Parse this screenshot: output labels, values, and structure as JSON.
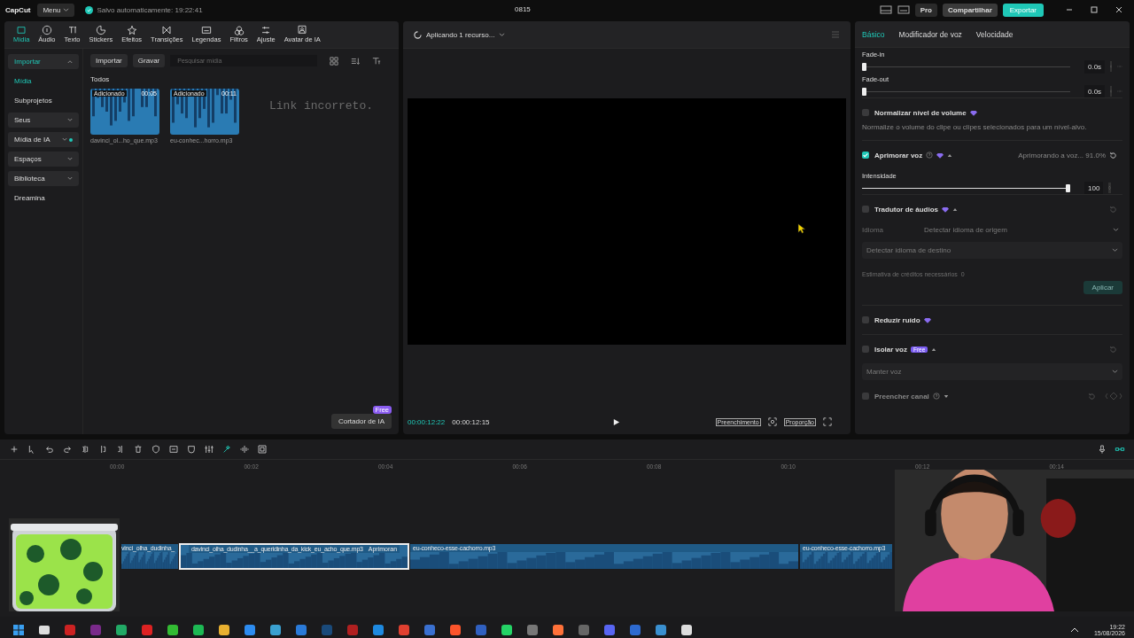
{
  "titlebar": {
    "logo": "CapCut",
    "menu": "Menu",
    "save_status": "Salvo automaticamente: 19:22:41",
    "project": "0815",
    "pro": "Pro",
    "share": "Compartilhar",
    "export": "Exportar"
  },
  "toolbar_tabs": [
    {
      "label": "Mídia",
      "selected": true
    },
    {
      "label": "Áudio",
      "selected": false
    },
    {
      "label": "Texto",
      "selected": false
    },
    {
      "label": "Stickers",
      "selected": false
    },
    {
      "label": "Efeitos",
      "selected": false
    },
    {
      "label": "Transições",
      "selected": false
    },
    {
      "label": "Legendas",
      "selected": false
    },
    {
      "label": "Filtros",
      "selected": false
    },
    {
      "label": "Ajuste",
      "selected": false
    },
    {
      "label": "Avatar de IA",
      "selected": false
    }
  ],
  "sidebar": {
    "items": [
      {
        "kind": "group",
        "label": "Importar",
        "selected": true,
        "expanded": true
      },
      {
        "kind": "item",
        "label": "Mídia",
        "selected": true
      },
      {
        "kind": "item",
        "label": "Subprojetos",
        "selected": false
      },
      {
        "kind": "group",
        "label": "Seus",
        "selected": false,
        "expanded": false
      },
      {
        "kind": "group",
        "label": "Mídia de IA",
        "selected": false,
        "expanded": false,
        "dot": true
      },
      {
        "kind": "group",
        "label": "Espaços",
        "selected": false,
        "expanded": false
      },
      {
        "kind": "group",
        "label": "Biblioteca",
        "selected": false,
        "expanded": false
      },
      {
        "kind": "item",
        "label": "Dreamina",
        "selected": false
      }
    ]
  },
  "media": {
    "import": "Importar",
    "record": "Gravar",
    "search": {
      "placeholder": "Pesquisar mídia"
    },
    "section": "Todos",
    "items": [
      {
        "badge": "Adicionado",
        "duration": "00:05",
        "name": "davinci_ol...ho_que.mp3"
      },
      {
        "badge": "Adicionado",
        "duration": "00:11",
        "name": "eu-conhec...horro.mp3"
      }
    ],
    "note": "Link incorreto.",
    "ai_cutter": "Cortador de IA",
    "ai_cutter_badge": "Free"
  },
  "preview": {
    "status": "Aplicando 1 recurso...",
    "current_time": "00:00:12:22",
    "total_time": "00:00:12:15",
    "fill": "Preenchimento",
    "ratio": "Proporção"
  },
  "inspector": {
    "tabs": [
      {
        "label": "Básico",
        "selected": true
      },
      {
        "label": "Modificador de voz",
        "selected": false
      },
      {
        "label": "Velocidade",
        "selected": false
      }
    ],
    "options": [
      {
        "kind": "slider",
        "label": "Fade-in",
        "level": 0,
        "value": "0.0s",
        "keyframe": true
      },
      {
        "kind": "slider",
        "label": "Fade-out",
        "level": 0,
        "value": "0.0s",
        "keyframe": true
      },
      {
        "kind": "toggle",
        "label": "Normalizar nível de volume",
        "checked": false,
        "pro": true,
        "help": false,
        "disabled": false,
        "description": "Normalize o volume do clipe ou clipes selecionados para um nível-alvo."
      },
      {
        "kind": "toggle",
        "label": "Aprimorar voz",
        "checked": true,
        "pro": true,
        "help": true,
        "expanded": true,
        "disabled": false,
        "status": "Aprimorando a voz... 91.0%"
      },
      {
        "kind": "slider",
        "label": "Intensidade",
        "level": 1,
        "value": "100",
        "keyframe": false
      },
      {
        "kind": "toggle",
        "label": "Tradutor de áudios",
        "checked": false,
        "pro": true,
        "help": false,
        "expanded": true,
        "disabled": false
      },
      {
        "kind": "select",
        "label": "Idioma",
        "value": "Detectar idioma de origem",
        "disabled": true
      },
      {
        "kind": "select",
        "value": "Detectar idioma de destino",
        "disabled": true
      },
      {
        "kind": "credits",
        "label": "Estimativa de créditos necessários",
        "value": "0",
        "disabled": true
      },
      {
        "kind": "button",
        "label": "Aplicar",
        "disabled": true
      },
      {
        "kind": "toggle",
        "label": "Reduzir ruído",
        "checked": false,
        "pro": true,
        "help": false,
        "disabled": false
      },
      {
        "kind": "toggle",
        "label": "Isolar voz",
        "checked": false,
        "pro": false,
        "help": false,
        "badge": "Free",
        "expanded": true,
        "disabled": false
      },
      {
        "kind": "select",
        "value": "Manter voz",
        "disabled": true
      },
      {
        "kind": "toggle",
        "label": "Preencher canal",
        "checked": false,
        "pro": false,
        "help": true,
        "expanded": false,
        "disabled": true
      }
    ]
  },
  "timeline": {
    "ruler": [
      "00:00",
      "00:02",
      "00:04",
      "00:06",
      "00:08",
      "00:10",
      "00:12",
      "00:14"
    ],
    "clips": [
      {
        "name": "vinci_olha_dudinha_",
        "selected": false
      },
      {
        "name": "davinci_olha_dudinha__a_queridinha_da_kick_eu_acho_que.mp3",
        "effect": "Aprimoran",
        "selected": true
      },
      {
        "name": "eu-conheco-esse-cachorro.mp3",
        "selected": false
      },
      {
        "name": "eu-conheco-esse-cachorro.mp3",
        "selected": false
      }
    ]
  },
  "taskbar": {
    "time": "19:22",
    "date": "15/08/2026"
  }
}
